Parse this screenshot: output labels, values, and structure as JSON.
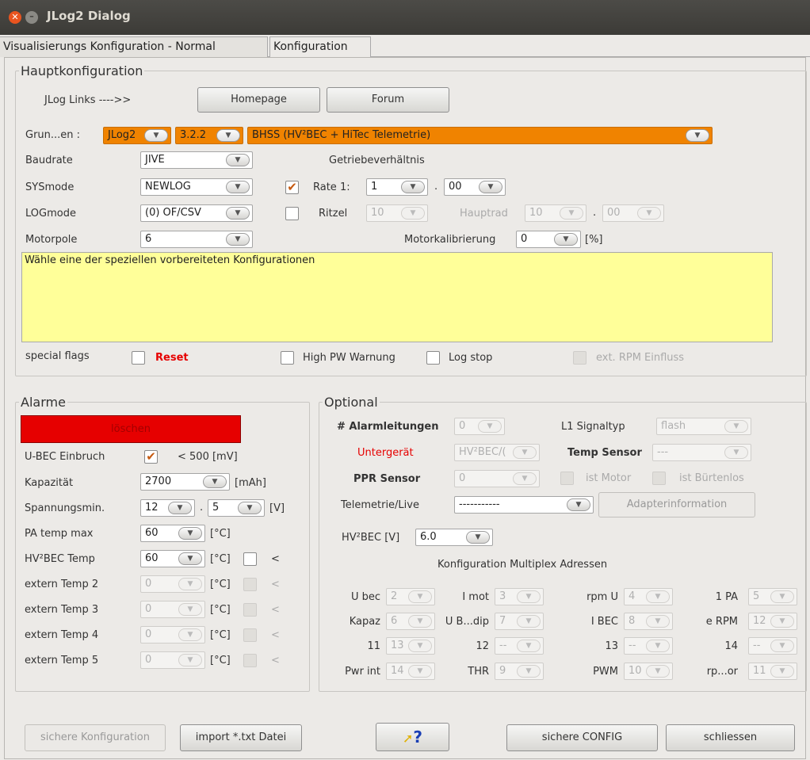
{
  "window": {
    "title": "JLog2 Dialog"
  },
  "tabs": [
    "Visualisierungs Konfiguration - Normal",
    "Konfiguration"
  ],
  "main": {
    "legend": "Hauptkonfiguration",
    "links_label": "JLog Links ---->>",
    "homepage": "Homepage",
    "forum": "Forum",
    "grund_label": "Grun...en :",
    "grund_combo1": "JLog2",
    "grund_combo2": "3.2.2",
    "grund_combo3": "BHSS  (HV²BEC + HiTec Telemetrie)",
    "baudrate_label": "Baudrate",
    "baudrate": "JIVE",
    "sysmode_label": "SYSmode",
    "sysmode": "NEWLOG",
    "logmode_label": "LOGmode",
    "logmode": "(0) OF/CSV",
    "motorpole_label": "Motorpole",
    "motorpole": "6",
    "getriebe_label": "Getriebeverhältnis",
    "rate_label": "Rate 1:",
    "rate_a": "1",
    "dot": ".",
    "rate_b": "00",
    "ritzel_label": "Ritzel",
    "ritzel": "10",
    "hauptrad_label": "Hauptrad",
    "hauptrad_a": "10",
    "hauptrad_b": "00",
    "motorkal_label": "Motorkalibrierung",
    "motorkal": "0",
    "percent": "[%]",
    "info_text": "Wähle eine der speziellen vorbereiteten Konfigurationen",
    "flags_label": "special flags",
    "reset": "Reset",
    "highpw": "High PW Warnung",
    "logstop": "Log stop",
    "extrpm": "ext. RPM Einfluss"
  },
  "alarme": {
    "legend": "Alarme",
    "loeschen": "löschen",
    "ubec_label": "U-BEC Einbruch",
    "ubec_val": "< 500 [mV]",
    "kap_label": "Kapazität",
    "kap": "2700",
    "mah": "[mAh]",
    "spann_label": "Spannungsmin.",
    "spann_a": "12",
    "spann_b": "5",
    "v": "[V]",
    "pa_label": "PA temp max",
    "pa": "60",
    "c": "[°C]",
    "hv_label": "HV²BEC Temp",
    "hv": "60",
    "lt": "<",
    "e2": "extern Temp 2",
    "e3": "extern Temp 3",
    "e4": "extern Temp 4",
    "e5": "extern Temp 5",
    "zero": "0"
  },
  "optional": {
    "legend": "Optional",
    "alarm_label": "# Alarmleitungen",
    "alarm": "0",
    "l1_label": "L1 Signaltyp",
    "l1": "flash",
    "unter_label": "Untergerät",
    "unter": "HV²BEC/(",
    "temps_label": "Temp Sensor",
    "temps": "---",
    "ppr_label": "PPR Sensor",
    "ppr": "0",
    "istmotor": "ist Motor",
    "istbuerst": "ist Bürtenlos",
    "tele_label": "Telemetrie/Live",
    "tele": "-----------",
    "adapter": "Adapterinformation",
    "hvv_label": "HV²BEC [V]",
    "hvv": "6.0",
    "multiplex_title": "Konfiguration Multiplex Adressen",
    "grid": [
      [
        [
          "U bec",
          "2"
        ],
        [
          "I mot",
          "3"
        ],
        [
          "rpm U",
          "4"
        ],
        [
          "1 PA",
          "5"
        ]
      ],
      [
        [
          "Kapaz",
          "6"
        ],
        [
          "U B...dip",
          "7"
        ],
        [
          "I BEC",
          "8"
        ],
        [
          "e RPM",
          "12"
        ]
      ],
      [
        [
          "11",
          "13"
        ],
        [
          "12",
          "--"
        ],
        [
          "13",
          "--"
        ],
        [
          "14",
          "--"
        ]
      ],
      [
        [
          "Pwr int",
          "14"
        ],
        [
          "THR",
          "9"
        ],
        [
          "PWM",
          "10"
        ],
        [
          "rp...or",
          "11"
        ]
      ]
    ]
  },
  "footer": {
    "save_conf": "sichere Konfiguration",
    "import": "import *.txt Datei",
    "help": "?",
    "save_config": "sichere CONFIG",
    "close": "schliessen"
  },
  "colors": {
    "orange": "#f08300",
    "yellow": "#ffff99",
    "red": "#e60000"
  }
}
